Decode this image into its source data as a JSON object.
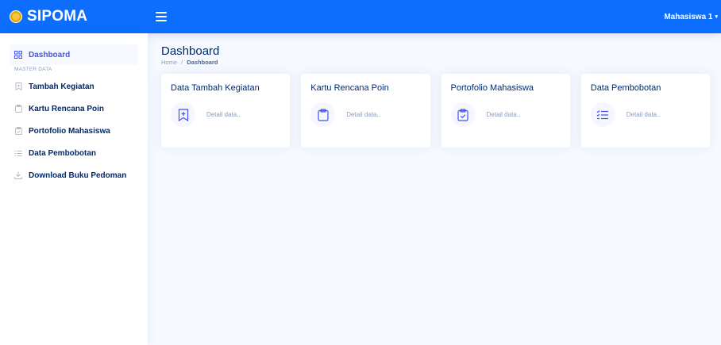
{
  "app": {
    "name": "SIPOMA"
  },
  "header": {
    "user_label": "Mahasiswa 1",
    "caret": "▾"
  },
  "sidebar": {
    "dashboard": "Dashboard",
    "heading": "MASTER DATA",
    "items": [
      {
        "label": "Tambah Kegiatan",
        "icon": "bookmark-plus-icon"
      },
      {
        "label": "Kartu Rencana Poin",
        "icon": "clipboard-icon"
      },
      {
        "label": "Portofolio Mahasiswa",
        "icon": "clipboard-check-icon"
      },
      {
        "label": "Data Pembobotan",
        "icon": "list-check-icon"
      },
      {
        "label": "Download Buku Pedoman",
        "icon": "download-icon"
      }
    ]
  },
  "main": {
    "title": "Dashboard",
    "breadcrumb": {
      "home": "Home",
      "separator": "/",
      "current": "Dashboard"
    },
    "cards": [
      {
        "title": "Data Tambah Kegiatan",
        "text": "Detail data..",
        "icon": "bookmark-plus-icon"
      },
      {
        "title": "Kartu Rencana Poin",
        "text": "Detail data..",
        "icon": "clipboard-icon"
      },
      {
        "title": "Portofolio Mahasiswa",
        "text": "Detail data..",
        "icon": "clipboard-check-icon"
      },
      {
        "title": "Data Pembobotan",
        "text": "Detail data..",
        "icon": "list-check-icon"
      }
    ]
  },
  "colors": {
    "topbar": "#0d6efd",
    "accent": "#4154f1",
    "text": "#012970",
    "muted": "#899bbd",
    "background": "#f6f9ff"
  }
}
